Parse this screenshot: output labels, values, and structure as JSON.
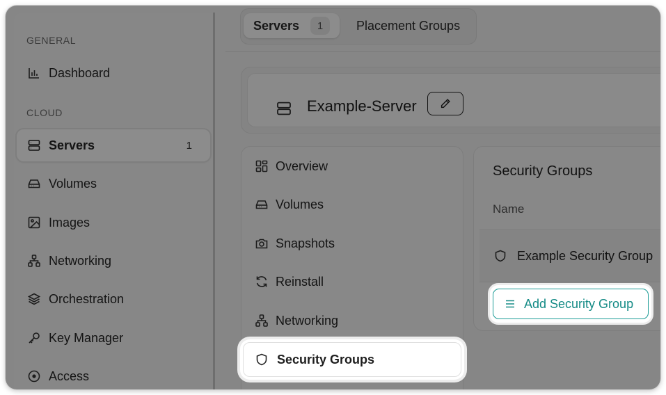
{
  "sidebar": {
    "sections": [
      {
        "label": "GENERAL"
      },
      {
        "label": "CLOUD"
      }
    ],
    "items": [
      {
        "label": "Dashboard",
        "icon": "bar-chart-icon"
      },
      {
        "label": "Servers",
        "icon": "server-icon",
        "count": "1"
      },
      {
        "label": "Volumes",
        "icon": "hard-drive-icon"
      },
      {
        "label": "Images",
        "icon": "image-icon"
      },
      {
        "label": "Networking",
        "icon": "network-icon"
      },
      {
        "label": "Orchestration",
        "icon": "layers-icon"
      },
      {
        "label": "Key Manager",
        "icon": "key-icon"
      },
      {
        "label": "Access",
        "icon": "access-icon"
      }
    ]
  },
  "tabs": [
    {
      "label": "Servers",
      "count": "1"
    },
    {
      "label": "Placement Groups"
    }
  ],
  "server": {
    "name": "Example-Server"
  },
  "subnav": {
    "items": [
      {
        "label": "Overview",
        "icon": "grid-icon"
      },
      {
        "label": "Volumes",
        "icon": "hard-drive-icon"
      },
      {
        "label": "Snapshots",
        "icon": "camera-icon"
      },
      {
        "label": "Reinstall",
        "icon": "refresh-icon"
      },
      {
        "label": "Networking",
        "icon": "network-icon"
      },
      {
        "label": "Security Groups",
        "icon": "shield-icon"
      }
    ]
  },
  "security_groups": {
    "title": "Security Groups",
    "column_name": "Name",
    "rows": [
      {
        "name": "Example Security Group"
      }
    ],
    "add_label": "Add Security Group"
  },
  "colors": {
    "accent": "#138a85",
    "dim_overlay": "rgba(0,0,0,0.45)"
  }
}
